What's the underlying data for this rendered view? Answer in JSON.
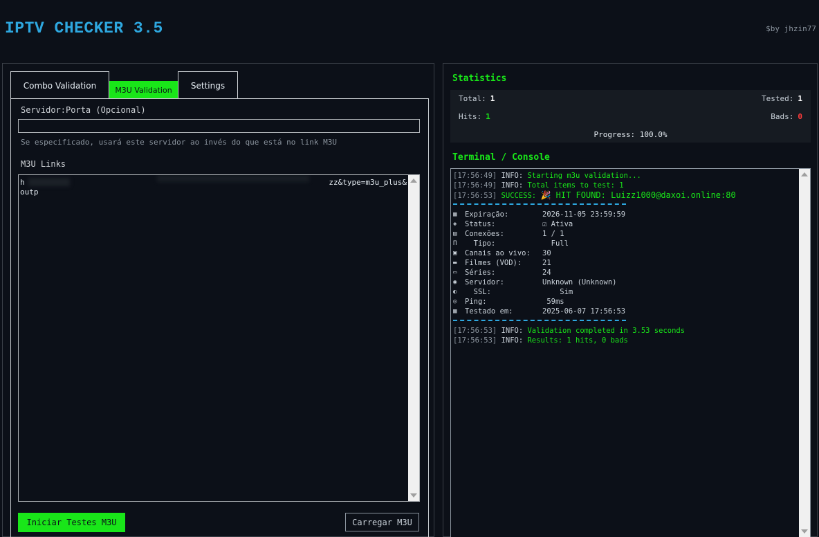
{
  "app": {
    "title": "IPTV CHECKER 3.5",
    "author": "$by jhzin77"
  },
  "tabs": [
    {
      "label": "Combo Validation"
    },
    {
      "label": "M3U Validation",
      "active": true
    },
    {
      "label": "Settings"
    }
  ],
  "m3u_form": {
    "server_label": "Servidor:Porta (Opcional)",
    "server_value": "",
    "server_hint": "Se especificado, usará este servidor ao invés do que está no link M3U",
    "links_label": "M3U Links",
    "links_line1_start": "h",
    "links_line1_end": "zz&type=m3u_plus&",
    "links_line2": "outp",
    "start_button": "Iniciar Testes M3U",
    "load_button": "Carregar M3U"
  },
  "statistics": {
    "title": "Statistics",
    "total_label": "Total:",
    "total": "1",
    "tested_label": "Tested:",
    "tested": "1",
    "hits_label": "Hits:",
    "hits": "1",
    "bads_label": "Bads:",
    "bads": "0",
    "progress_label": "Progress:",
    "progress": "100.0%",
    "progress_value": 1.0
  },
  "console": {
    "title": "Terminal / Console",
    "lines": [
      {
        "ts": "[17:56:49]",
        "level": "INFO:",
        "msg": "Starting m3u validation..."
      },
      {
        "ts": "[17:56:49]",
        "level": "INFO:",
        "msg": "Total items to test: 1"
      },
      {
        "ts": "[17:56:53]",
        "level": "SUCCESS:",
        "msg": "🎉 HIT FOUND: Luizz1000@daxoi.online:80"
      }
    ],
    "details": [
      {
        "icon": "▦",
        "key": "Expiração:",
        "value": "2026-11-05 23:59:59"
      },
      {
        "icon": "◈",
        "key": "Status:",
        "value": "☑ Ativa"
      },
      {
        "icon": "▤",
        "key": "Conexões:",
        "value": "1 / 1"
      },
      {
        "icon": "Π",
        "key": "  Tipo:",
        "value": "  Full"
      },
      {
        "icon": "▣",
        "key": "Canais ao vivo:",
        "value": "30"
      },
      {
        "icon": "▬",
        "key": "Filmes (VOD):",
        "value": "21"
      },
      {
        "icon": "▭",
        "key": "Séries:",
        "value": "24"
      },
      {
        "icon": "◉",
        "key": "Servidor:",
        "value": "Unknown (Unknown)"
      },
      {
        "icon": "◐",
        "key": "  SSL:",
        "value": "    Sim"
      },
      {
        "icon": "◎",
        "key": "Ping:",
        "value": " 59ms"
      },
      {
        "icon": "▦",
        "key": "Testado em:",
        "value": "2025-06-07 17:56:53"
      }
    ],
    "footer_lines": [
      {
        "ts": "[17:56:53]",
        "level": "INFO:",
        "msg": "Validation completed in 3.53 seconds"
      },
      {
        "ts": "[17:56:53]",
        "level": "INFO:",
        "msg": "Results: 1 hits, 0 bads"
      }
    ]
  },
  "colors": {
    "accent_green": "#19e619",
    "title_blue": "#2ea8e0",
    "bad_red": "#ff3b3b",
    "background": "#0c1018"
  }
}
